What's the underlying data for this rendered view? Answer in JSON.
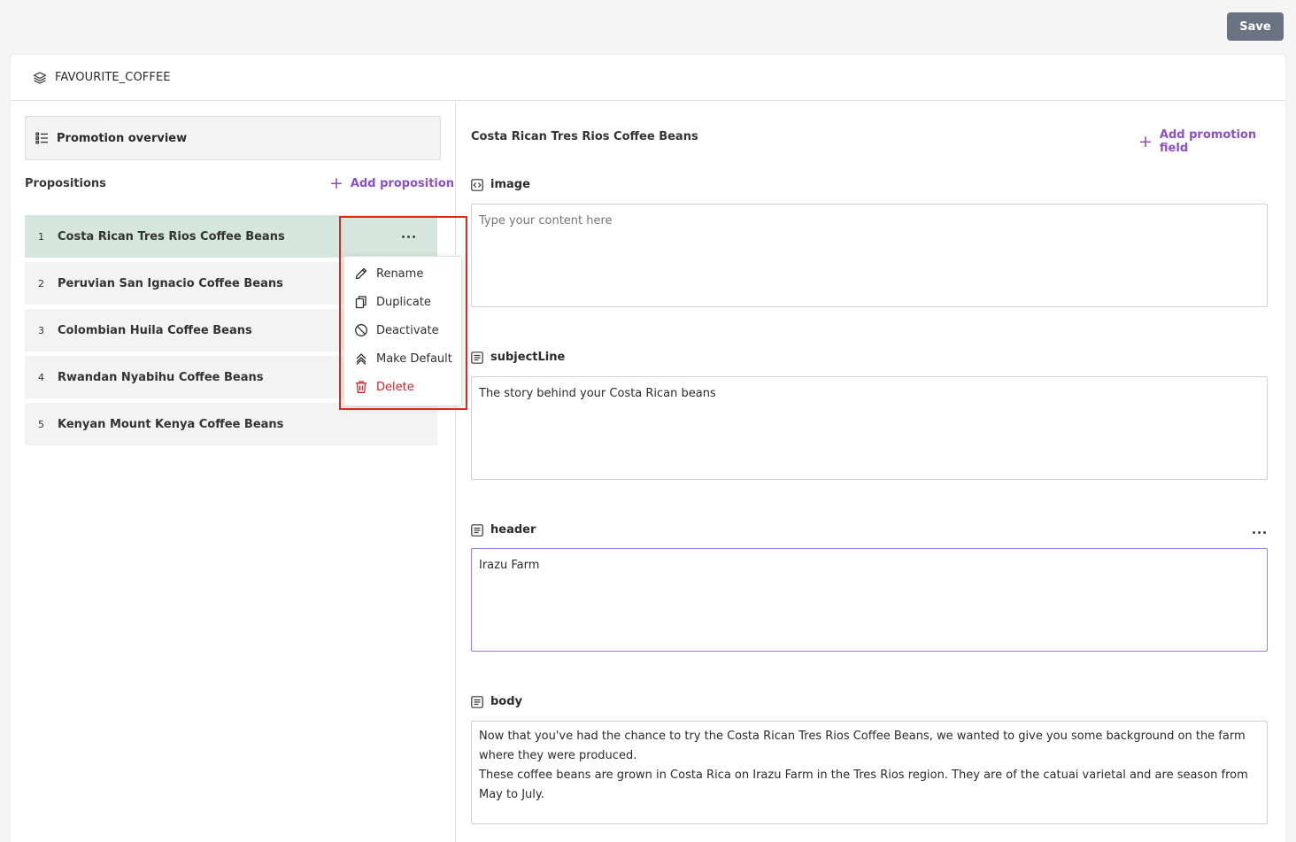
{
  "toolbar": {
    "save_label": "Save"
  },
  "header": {
    "title": "FAVOURITE_COFFEE",
    "icon": "layers-icon"
  },
  "left": {
    "overview_label": "Promotion overview",
    "propositions_heading": "Propositions",
    "add_proposition_label": "Add proposition",
    "propositions": [
      {
        "num": "1",
        "name": "Costa Rican Tres Rios Coffee Beans"
      },
      {
        "num": "2",
        "name": "Peruvian San Ignacio Coffee Beans"
      },
      {
        "num": "3",
        "name": "Colombian Huila Coffee Beans"
      },
      {
        "num": "4",
        "name": "Rwandan Nyabihu Coffee Beans"
      },
      {
        "num": "5",
        "name": "Kenyan Mount Kenya Coffee Beans"
      }
    ],
    "menu": {
      "rename": "Rename",
      "duplicate": "Duplicate",
      "deactivate": "Deactivate",
      "make_default": "Make Default",
      "delete": "Delete"
    }
  },
  "right": {
    "title": "Costa Rican Tres Rios Coffee Beans",
    "add_field_label": "Add promotion field",
    "fields": {
      "image": {
        "label": "image",
        "value": "",
        "placeholder": "Type your content here"
      },
      "subjectLine": {
        "label": "subjectLine",
        "value": "The story behind your Costa Rican beans"
      },
      "header": {
        "label": "header",
        "value": "Irazu Farm"
      },
      "body": {
        "label": "body",
        "line1": "Now that you've had the chance to try the Costa Rican Tres Rios Coffee Beans, we wanted to give you some background on the farm where they were produced.",
        "line2": "These coffee beans are grown in Costa Rica on Irazu Farm in the Tres Rios region. They are of the catuai varietal and are season from May to July."
      }
    }
  },
  "colors": {
    "accent": "#8a4fc9",
    "active_row": "#d4e6dd",
    "danger": "#c9252c",
    "save_button": "#6b7382"
  }
}
